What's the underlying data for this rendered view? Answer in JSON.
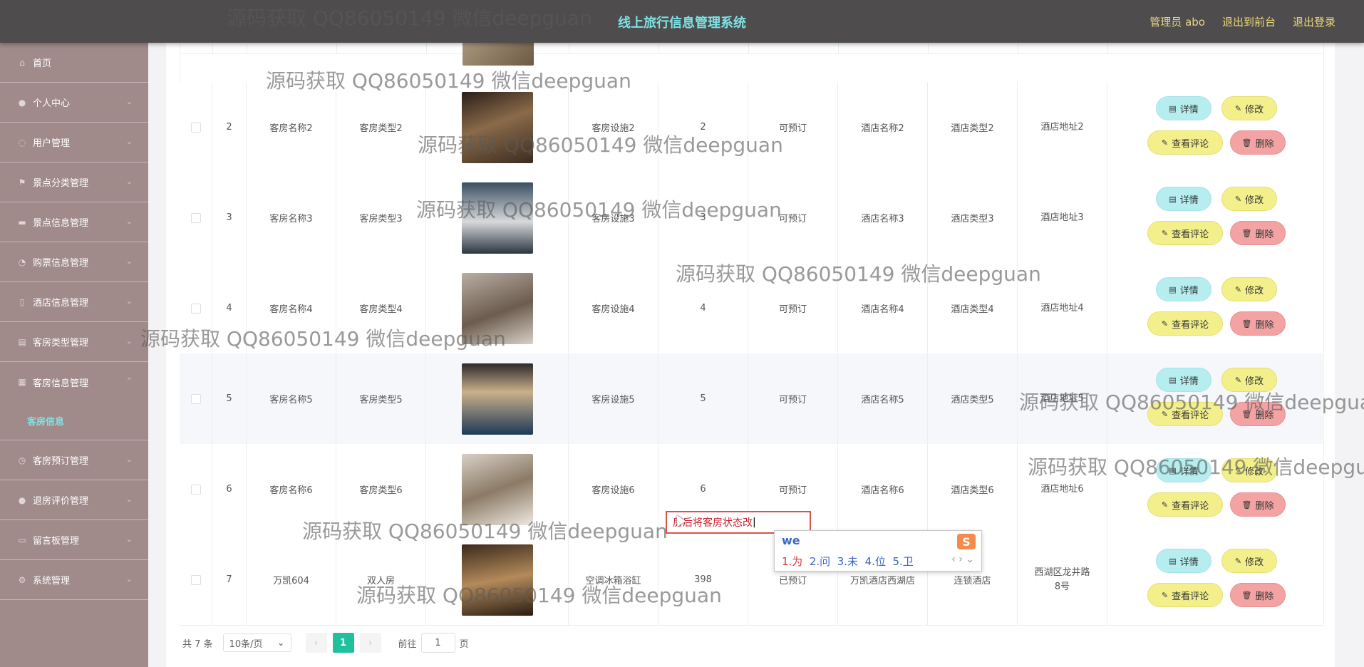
{
  "header": {
    "title": "线上旅行信息管理系统",
    "admin": "管理员 abo",
    "to_front": "退出到前台",
    "logout": "退出登录"
  },
  "sidebar": {
    "items": [
      {
        "label": "首页",
        "icon": "home-icon"
      },
      {
        "label": "个人中心",
        "icon": "user-icon"
      },
      {
        "label": "用户管理",
        "icon": "users-icon"
      },
      {
        "label": "景点分类管理",
        "icon": "flag-icon"
      },
      {
        "label": "景点信息管理",
        "icon": "message-icon"
      },
      {
        "label": "购票信息管理",
        "icon": "ticket-icon"
      },
      {
        "label": "酒店信息管理",
        "icon": "document-icon"
      },
      {
        "label": "客房类型管理",
        "icon": "list-icon"
      },
      {
        "label": "客房信息管理",
        "icon": "bed-icon"
      },
      {
        "label": "客房预订管理",
        "icon": "clock-icon"
      },
      {
        "label": "退房评价管理",
        "icon": "person-icon"
      },
      {
        "label": "留言板管理",
        "icon": "chat-icon"
      },
      {
        "label": "系统管理",
        "icon": "gear-icon"
      }
    ],
    "active_sub": "客房信息"
  },
  "table": {
    "rows": [
      {
        "id": "2",
        "name": "客房名称2",
        "type": "客房类型2",
        "facility": "客房设施2",
        "price": "2",
        "status": "可预订",
        "hotel": "酒店名称2",
        "hotel_type": "酒店类型2",
        "address": "酒店地址2"
      },
      {
        "id": "3",
        "name": "客房名称3",
        "type": "客房类型3",
        "facility": "客房设施3",
        "price": "3",
        "status": "可预订",
        "hotel": "酒店名称3",
        "hotel_type": "酒店类型3",
        "address": "酒店地址3"
      },
      {
        "id": "4",
        "name": "客房名称4",
        "type": "客房类型4",
        "facility": "客房设施4",
        "price": "4",
        "status": "可预订",
        "hotel": "酒店名称4",
        "hotel_type": "酒店类型4",
        "address": "酒店地址4"
      },
      {
        "id": "5",
        "name": "客房名称5",
        "type": "客房类型5",
        "facility": "客房设施5",
        "price": "5",
        "status": "可预订",
        "hotel": "酒店名称5",
        "hotel_type": "酒店类型5",
        "address": "酒店地址5"
      },
      {
        "id": "6",
        "name": "客房名称6",
        "type": "客房类型6",
        "facility": "客房设施6",
        "price": "6",
        "status": "可预订",
        "hotel": "酒店名称6",
        "hotel_type": "酒店类型6",
        "address": "酒店地址6"
      },
      {
        "id": "7",
        "name": "万凯604",
        "type": "双人房",
        "facility": "空调冰箱浴缸",
        "price": "398",
        "status": "已预订",
        "hotel": "万凯酒店西湖店",
        "hotel_type": "连锁酒店",
        "address": "西湖区龙井路8号"
      }
    ],
    "actions": {
      "detail": "详情",
      "edit": "修改",
      "comment": "查看评论",
      "delete": "删除"
    }
  },
  "pagination": {
    "total": "共 7 条",
    "page_size": "10条/页",
    "current": "1",
    "goto_label": "前往",
    "goto_value": "1",
    "page_unit": "页"
  },
  "ime": {
    "composing": "房后将客房状态改",
    "code": "we",
    "candidates": [
      "1.为",
      "2.问",
      "3.未",
      "4.位",
      "5.卫"
    ]
  },
  "watermark": "源码获取 QQ86050149 微信deepguan",
  "colors": {
    "header": "#4e4c4c",
    "sidebar": "#a08a8a",
    "accent": "#7ee3e6",
    "page_active": "#21c09c"
  }
}
